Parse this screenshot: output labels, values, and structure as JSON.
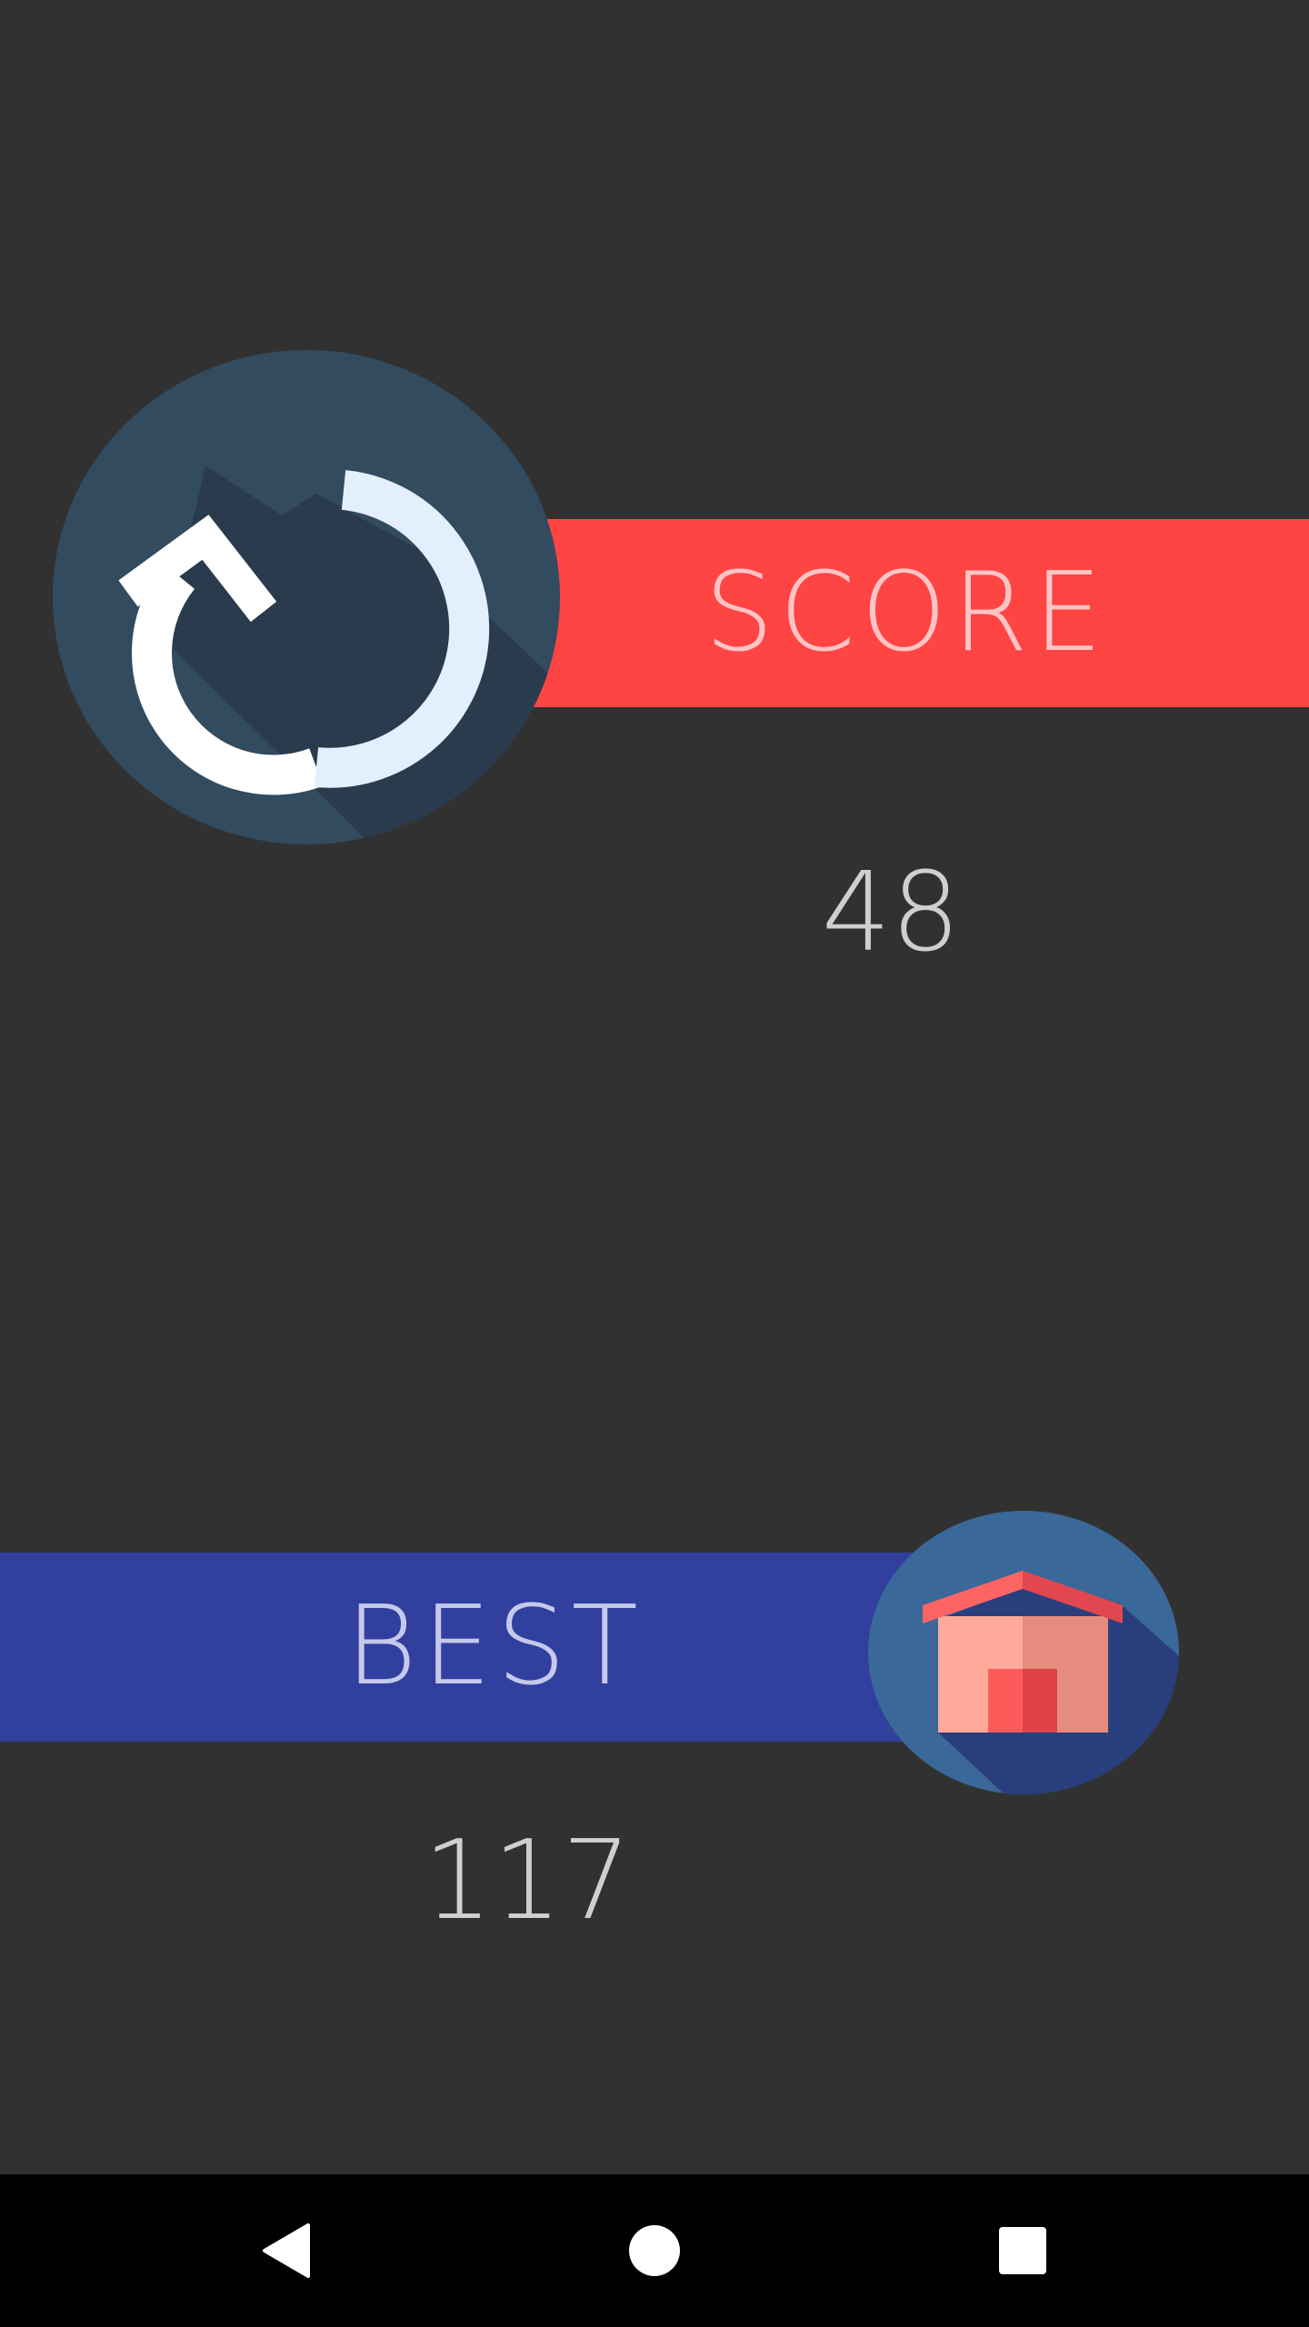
{
  "score": {
    "label": "SCORE",
    "value": "48"
  },
  "best": {
    "label": "BEST",
    "value": "117"
  },
  "buttons": {
    "restart_icon": "restart-icon",
    "home_icon": "home-icon"
  },
  "nav": {
    "back_icon": "back-triangle-icon",
    "home_icon": "home-circle-icon",
    "recents_icon": "recents-square-icon"
  },
  "colors": {
    "background": "#313131",
    "score_banner": "#ff4444",
    "score_text": "#ffc4c4",
    "best_banner": "#313f9f",
    "best_text": "#c5c9ea",
    "value_text": "#cfcfcf",
    "restart_circle": "#324b5f",
    "home_circle": "#3a6898",
    "nav_bar": "#000000"
  }
}
